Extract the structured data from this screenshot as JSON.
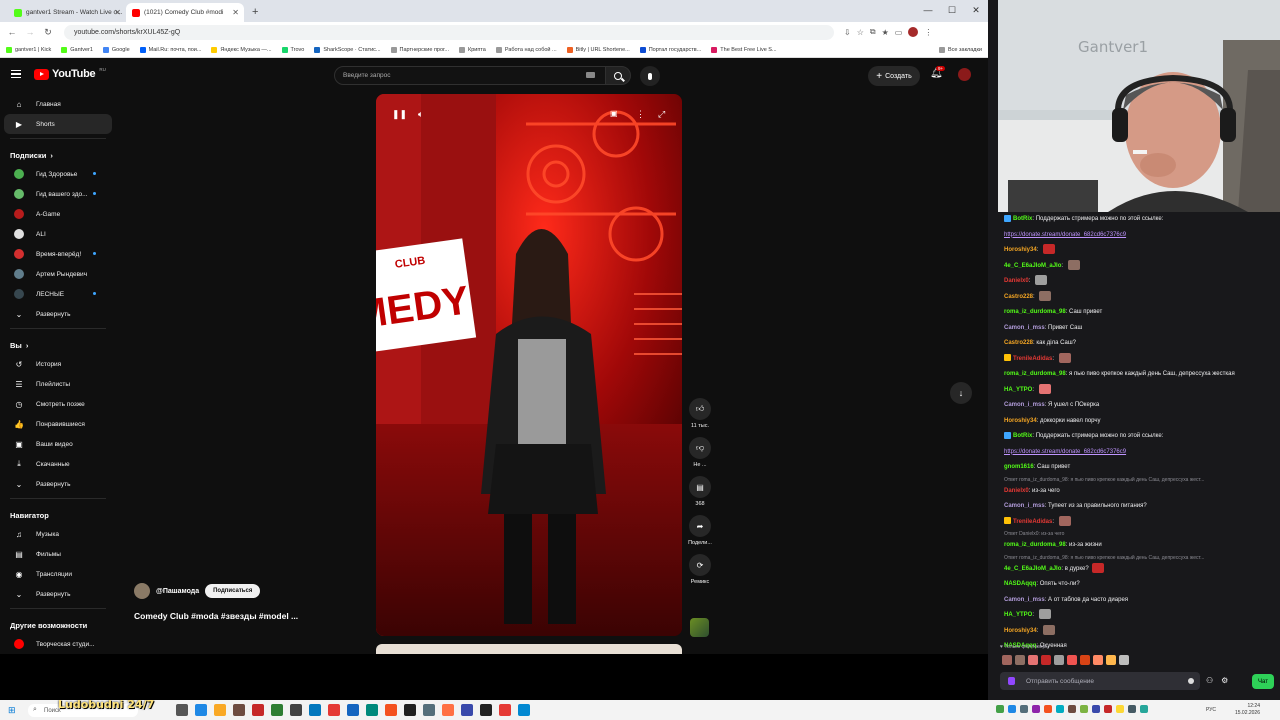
{
  "browser": {
    "tabs": [
      {
        "label": "gantver1 Stream - Watch Live o...",
        "color": "#53fc18"
      },
      {
        "label": "(1021) Comedy Club #modi",
        "color": "#ff0000"
      }
    ],
    "url": "youtube.com/shorts/krXUL45Z-gQ",
    "bookmarks": [
      {
        "label": "gantver1 | Kick",
        "color": "#53fc18"
      },
      {
        "label": "Gantver1",
        "color": "#53fc18"
      },
      {
        "label": "Google",
        "color": "#4285f4"
      },
      {
        "label": "Mail.Ru: почта, пои...",
        "color": "#005ff9"
      },
      {
        "label": "Яндекс Музыка —...",
        "color": "#ffcc00"
      },
      {
        "label": "Trovo",
        "color": "#19d66b"
      },
      {
        "label": "SharkScope · Статис...",
        "color": "#1565c0"
      },
      {
        "label": "Партнерские прог...",
        "color": "#999999"
      },
      {
        "label": "Крипта",
        "color": "#999999"
      },
      {
        "label": "Работа над собой ...",
        "color": "#999999"
      },
      {
        "label": "Bitly | URL Shortene...",
        "color": "#ee6123"
      },
      {
        "label": "Портал государств...",
        "color": "#0d4cd3"
      },
      {
        "label": "The Best Free Live S...",
        "color": "#d81b60"
      },
      {
        "label": "Все закладки",
        "color": "#999999"
      }
    ]
  },
  "youtube": {
    "logo": "YouTube",
    "logo_region": "RU",
    "search_placeholder": "Введите запрос",
    "create_label": "Создать",
    "notifications_badge": "9+",
    "sidebar": {
      "main": [
        {
          "label": "Главная",
          "icon": "home-icon",
          "glyph": "⌂"
        },
        {
          "label": "Shorts",
          "icon": "shorts-icon",
          "glyph": "▶",
          "active": true
        }
      ],
      "subs_header": "Подписки",
      "subs": [
        {
          "label": "Гид Здоровье",
          "color": "#4caf50",
          "dot": true
        },
        {
          "label": "Гид вашего здо...",
          "color": "#66bb6a",
          "dot": true
        },
        {
          "label": "A-Game",
          "color": "#b71c1c",
          "dot": false
        },
        {
          "label": "ALI",
          "color": "#e0e0e0",
          "dot": false
        },
        {
          "label": "Время-вперёд!",
          "color": "#d32f2f",
          "dot": true
        },
        {
          "label": "Артем Рындевич",
          "color": "#607d8b",
          "dot": false
        },
        {
          "label": "ЛЕСНЫЕ",
          "color": "#37474f",
          "dot": true
        }
      ],
      "expand_label": "Развернуть",
      "you_header": "Вы",
      "you": [
        {
          "label": "История",
          "glyph": "↺"
        },
        {
          "label": "Плейлисты",
          "glyph": "☰"
        },
        {
          "label": "Смотреть позже",
          "glyph": "◷"
        },
        {
          "label": "Понравившиеся",
          "glyph": "👍"
        },
        {
          "label": "Ваши видео",
          "glyph": "▣"
        },
        {
          "label": "Скачанные",
          "glyph": "⤓"
        }
      ],
      "nav_header": "Навигатор",
      "nav": [
        {
          "label": "Музыка",
          "glyph": "♫"
        },
        {
          "label": "Фильмы",
          "glyph": "▤"
        },
        {
          "label": "Трансляции",
          "glyph": "◉"
        }
      ],
      "other_header": "Другие возможности",
      "other": [
        {
          "label": "Творческая студи...",
          "color": "#ff0000"
        }
      ]
    },
    "short": {
      "channel": "@Пашамода",
      "subscribe_label": "Подписаться",
      "title": "Comedy Club #moda #звезды #model ...",
      "likes": "11 тыс.",
      "dislike_label": "Не ...",
      "comments": "368",
      "share_label": "Подели...",
      "remix_label": "Ремикс",
      "sign_text": "MEDY",
      "sign_small": "CLUB"
    }
  },
  "stream": {
    "wall_text": "Gantver1",
    "chat": [
      {
        "user": "BotRix",
        "color": "#53fc18",
        "badge": "#3ea6ff",
        "text": "Поддержать стримера можно по этой ссылке:"
      },
      {
        "link": "https://donate.stream/donate_682cd6c7376c9"
      },
      {
        "user": "Horoshiy34",
        "color": "#f5a623",
        "text": "",
        "emote": "#c62828"
      },
      {
        "user": "4e_C_E6aJIoM_aJIo",
        "color": "#53fc18",
        "text": "",
        "emote": "#8d6e63"
      },
      {
        "user": "Danielx0",
        "color": "#e53935",
        "text": "",
        "emote": "#9e9e9e"
      },
      {
        "user": "Castro228",
        "color": "#f5a623",
        "text": "",
        "emote": "#8d6e63"
      },
      {
        "user": "roma_iz_durdoma_98",
        "color": "#53fc18",
        "text": "Саш привет"
      },
      {
        "user": "Camon_i_mss",
        "color": "#b39ddb",
        "text": "Привет Саш"
      },
      {
        "user": "Castro228",
        "color": "#f5a623",
        "text": "как діла Саш?"
      },
      {
        "user": "TrenileAdidas",
        "color": "#e53935",
        "badge": "#ffc107",
        "text": "",
        "emote": "#a1665e"
      },
      {
        "user": "roma_iz_durdoma_98",
        "color": "#53fc18",
        "text": "я пью пиво крепкое каждый день Саш, депрессуха жесткая"
      },
      {
        "user": "HA_YTPO",
        "color": "#53fc18",
        "text": "",
        "emote": "#e57373"
      },
      {
        "user": "Camon_i_mss",
        "color": "#b39ddb",
        "text": "Я ушел с ПОкерка"
      },
      {
        "user": "Horoshiy34",
        "color": "#f5a623",
        "text": "доккорки навел порчу"
      },
      {
        "user": "BotRix",
        "color": "#53fc18",
        "badge": "#3ea6ff",
        "text": "Поддержать стримера можно по этой ссылке:"
      },
      {
        "link": "https://donate.stream/donate_682cd6c7376c9"
      },
      {
        "user": "gnom1616",
        "color": "#53fc18",
        "text": "Саш привет"
      },
      {
        "reply": "Ответ roma_iz_durdoma_98: я пью пиво крепкое каждый день Саш, депрессуха жест..."
      },
      {
        "user": "Danielx0",
        "color": "#e53935",
        "text": "из-за чего"
      },
      {
        "user": "Camon_i_mss",
        "color": "#b39ddb",
        "text": "Тупеет из за правильного питания?"
      },
      {
        "user": "TrenileAdidas",
        "color": "#e53935",
        "badge": "#ffc107",
        "text": "",
        "emote": "#a1665e"
      },
      {
        "reply": "Ответ Danielx0: из-за чего"
      },
      {
        "user": "roma_iz_durdoma_98",
        "color": "#53fc18",
        "text": "из-за жизни"
      },
      {
        "reply": "Ответ roma_iz_durdoma_98: я пью пиво крепкое каждый день Саш, депрессуха жест..."
      },
      {
        "user": "4e_C_E6aJIoM_aJIo",
        "color": "#53fc18",
        "text": "в дурке?",
        "emote": "#c62828"
      },
      {
        "user": "NASDAqqq",
        "color": "#53fc18",
        "text": "Опять что-ли?"
      },
      {
        "user": "Camon_i_mss",
        "color": "#b39ddb",
        "text": "А от таблов да часто диарея"
      },
      {
        "user": "HA_YTPO",
        "color": "#53fc18",
        "text": "",
        "emote": "#9e9e9e"
      },
      {
        "user": "Horoshiy34",
        "color": "#f5a623",
        "text": "",
        "emote": "#8d6e63"
      },
      {
        "user": "NASDAqqq",
        "color": "#53fc18",
        "text": "Охуенная"
      }
    ],
    "followers_only": "Только фолловеры",
    "chat_placeholder": "Отправить сообщение",
    "chat_button": "Чат",
    "overlay_text": "Ludobudni 24/7"
  },
  "taskbar": {
    "search_label": "Поиск",
    "lang": "РУС",
    "time": "12:24",
    "date": "15.02.2026"
  }
}
